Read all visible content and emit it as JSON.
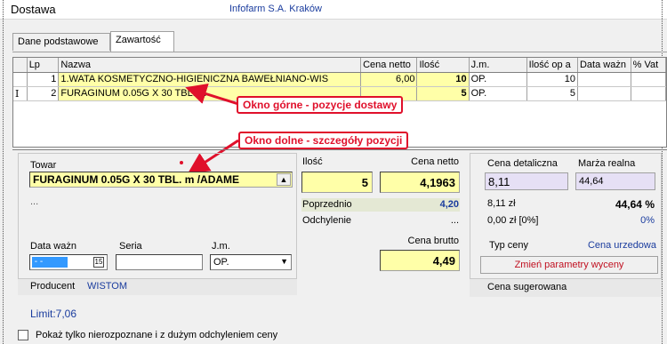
{
  "window": {
    "title": "Dostawa",
    "company": "Infofarm S.A. Kraków"
  },
  "tabs": [
    {
      "label": "Dane podstawowe"
    },
    {
      "label": "Zawartość"
    }
  ],
  "grid": {
    "columns": [
      "Lp",
      "Nazwa",
      "Cena netto",
      "Ilość",
      "J.m.",
      "Ilość op a",
      "Data ważn",
      "% Vat"
    ],
    "rows": [
      {
        "marker": "",
        "lp": "1",
        "name": "1.WATA KOSMETYCZNO-HIGIENICZNA BAWEŁNIANO-WIS",
        "price": "6,00",
        "qty": "10",
        "unit": "OP.",
        "qty_op": "10"
      },
      {
        "marker": "I",
        "lp": "2",
        "name": "FURAGINUM  0.05G X 30 TBL. m",
        "price": "",
        "qty": "5",
        "unit": "OP.",
        "qty_op": "5"
      }
    ]
  },
  "annotations": {
    "upper": "Okno górne - pozycje dostawy",
    "lower": "Okno dolne - szczegóły pozycji"
  },
  "detail": {
    "towar_label": "Towar",
    "towar_value": "FURAGINUM  0.05G X 30 TBL. m  /ADAME",
    "towar_more": "...",
    "data_waz_label": "Data ważn",
    "data_waz_value": " - -",
    "seria_label": "Seria",
    "seria_value": "",
    "jm_label": "J.m.",
    "jm_value": "OP.",
    "producent_label": "Producent",
    "producent_value": "WISTOM",
    "ilosc_label": "Ilość",
    "ilosc_value": "5",
    "cena_netto_label": "Cena netto",
    "cena_netto_value": "4,1963",
    "poprzednio_label": "Poprzednio",
    "poprzednio_value": "4,20",
    "odchylenie_label": "Odchylenie",
    "odchylenie_value": "...",
    "cena_brutto_label": "Cena brutto",
    "cena_brutto_value": "4,49",
    "cena_det_label": "Cena detaliczna",
    "cena_det_value": "8,11",
    "marza_label": "Marża realna",
    "marza_value": "44,64",
    "zl_value": "8,11 zł",
    "marza_pct": "44,64 %",
    "zero_value": "0,00 zł [0%]",
    "zero_pct": "0%",
    "typ_ceny_label": "Typ ceny",
    "typ_ceny_value": "Cena urzedowa",
    "zmien_label": "Zmień parametry wyceny",
    "cena_sug_label": "Cena sugerowana",
    "limit": "Limit:7,06",
    "checkbox_label": "Pokaż tylko nierozpoznane i z dużym odchyleniem ceny"
  },
  "colors": {
    "accent_red": "#e0102b",
    "yellow": "#ffffa8",
    "blue_text": "#1a3c9e"
  }
}
